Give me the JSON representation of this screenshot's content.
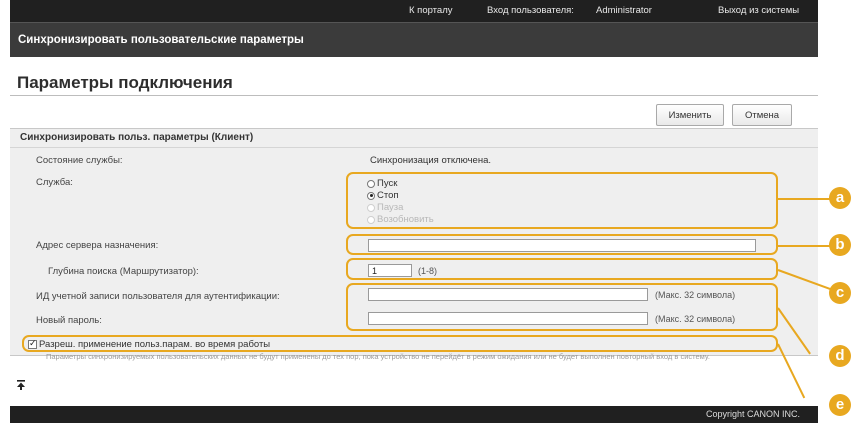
{
  "header": {
    "portal_link": "К порталу",
    "login_label": "Вход пользователя:",
    "user_name": "Administrator",
    "logout_link": "Выход из системы"
  },
  "window_title": "Синхронизировать пользовательские параметры",
  "page_title": "Параметры подключения",
  "toolbar": {
    "change_label": "Изменить",
    "cancel_label": "Отмена"
  },
  "section": {
    "title": "Синхронизировать польз. параметры (Клиент)",
    "service_status_label": "Состояние службы:",
    "service_status_value": "Синхронизация отключена.",
    "service_label": "Служба:",
    "service_options": [
      {
        "label": "Пуск",
        "checked": false,
        "disabled": false
      },
      {
        "label": "Стоп",
        "checked": true,
        "disabled": false
      },
      {
        "label": "Пауза",
        "checked": false,
        "disabled": true
      },
      {
        "label": "Возобновить",
        "checked": false,
        "disabled": true
      }
    ],
    "server_address_label": "Адрес сервера назначения:",
    "server_address_value": "",
    "search_depth_label": "Глубина поиска (Маршрутизатор):",
    "search_depth_value": "1",
    "search_depth_range": "(1-8)",
    "account_id_label": "ИД учетной записи пользователя для аутентификации:",
    "account_id_value": "",
    "account_id_hint": "(Макс. 32 символа)",
    "new_password_label": "Новый пароль:",
    "new_password_value": "",
    "new_password_hint": "(Макс. 32 символа)",
    "allow_apply_label": "Разреш. применение польз.парам. во время работы",
    "allow_apply_checked": true,
    "note": "Параметры синхронизируемых пользовательских данных не будут применены до тех пор, пока устройство не перейдёт в режим ожидания или не будет выполнен повторный вход в систему."
  },
  "callouts": [
    "a",
    "b",
    "c",
    "d",
    "e"
  ],
  "back_to_top_icon": "arrow-up-to-top-icon",
  "footer": {
    "copyright": "Copyright CANON INC."
  },
  "colors": {
    "accent": "#e8a820",
    "topbar": "#202020",
    "titlebar": "#3b3b3b",
    "panel": "#efefef"
  }
}
